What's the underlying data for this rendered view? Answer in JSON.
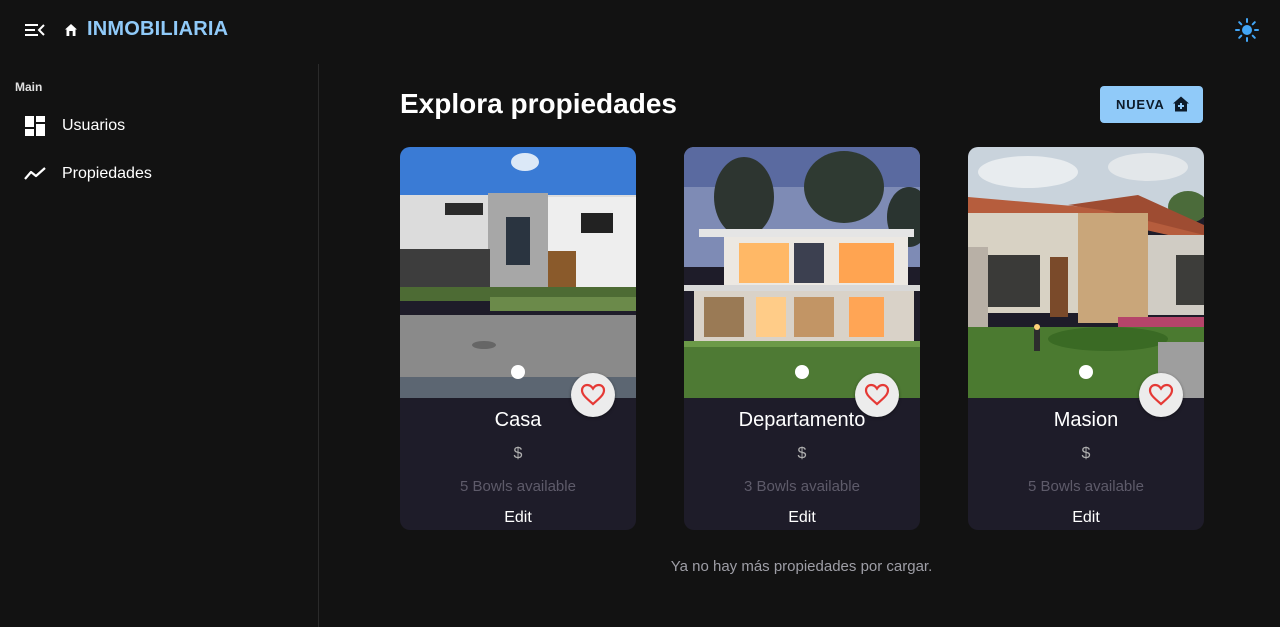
{
  "appbar": {
    "brand": "INMOBILIARIA",
    "menu_icon": "menu-open-icon",
    "brand_icon": "home-icon",
    "theme_icon": "sun-icon",
    "brand_color": "#90caf9"
  },
  "sidebar": {
    "section_title": "Main",
    "items": [
      {
        "label": "Usuarios",
        "icon": "dashboard-icon"
      },
      {
        "label": "Propiedades",
        "icon": "trending-line-icon"
      }
    ]
  },
  "main": {
    "title": "Explora propiedades",
    "new_button": {
      "label": "NUEVA",
      "icon": "add-home-icon",
      "color": "#90caf9"
    },
    "cards": [
      {
        "name": "Casa",
        "price": "$",
        "availability": "5 Bowls available",
        "edit_label": "Edit",
        "image": "modern-white-house-photo",
        "favorite_icon": "heart-outline-icon"
      },
      {
        "name": "Departamento",
        "price": "$",
        "availability": "3 Bowls available",
        "edit_label": "Edit",
        "image": "two-story-house-dusk-photo",
        "favorite_icon": "heart-outline-icon"
      },
      {
        "name": "Masion",
        "price": "$",
        "availability": "5 Bowls available",
        "edit_label": "Edit",
        "image": "single-story-tile-roof-house-photo",
        "favorite_icon": "heart-outline-icon"
      }
    ],
    "end_message": "Ya no hay más propiedades por cargar."
  },
  "colors": {
    "background": "#121212",
    "card": "#1e1c29",
    "heart": "#e53935"
  }
}
